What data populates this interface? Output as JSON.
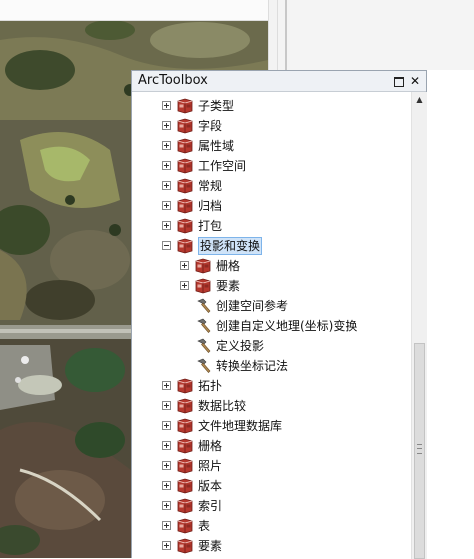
{
  "panel": {
    "title": "ArcToolbox",
    "restore_label": "",
    "close_label": "✕"
  },
  "tree": {
    "items": [
      {
        "label": "子类型",
        "type": "toolbox",
        "expander": "plus"
      },
      {
        "label": "字段",
        "type": "toolbox",
        "expander": "plus"
      },
      {
        "label": "属性域",
        "type": "toolbox",
        "expander": "plus"
      },
      {
        "label": "工作空间",
        "type": "toolbox",
        "expander": "plus"
      },
      {
        "label": "常规",
        "type": "toolbox",
        "expander": "plus"
      },
      {
        "label": "归档",
        "type": "toolbox",
        "expander": "plus"
      },
      {
        "label": "打包",
        "type": "toolbox",
        "expander": "plus"
      },
      {
        "label": "投影和变换",
        "type": "toolbox",
        "expander": "minus",
        "selected": true
      },
      {
        "label": "栅格",
        "type": "toolbox",
        "expander": "plus",
        "child": true
      },
      {
        "label": "要素",
        "type": "toolbox",
        "expander": "plus",
        "child": true
      },
      {
        "label": "创建空间参考",
        "type": "tool",
        "child": true
      },
      {
        "label": "创建自定义地理(坐标)变换",
        "type": "tool",
        "child": true
      },
      {
        "label": "定义投影",
        "type": "tool",
        "child": true
      },
      {
        "label": "转换坐标记法",
        "type": "tool",
        "child": true
      },
      {
        "label": "拓扑",
        "type": "toolbox",
        "expander": "plus"
      },
      {
        "label": "数据比较",
        "type": "toolbox",
        "expander": "plus"
      },
      {
        "label": "文件地理数据库",
        "type": "toolbox",
        "expander": "plus"
      },
      {
        "label": "栅格",
        "type": "toolbox",
        "expander": "plus"
      },
      {
        "label": "照片",
        "type": "toolbox",
        "expander": "plus"
      },
      {
        "label": "版本",
        "type": "toolbox",
        "expander": "plus"
      },
      {
        "label": "索引",
        "type": "toolbox",
        "expander": "plus"
      },
      {
        "label": "表",
        "type": "toolbox",
        "expander": "plus"
      },
      {
        "label": "要素",
        "type": "toolbox",
        "expander": "plus"
      }
    ]
  },
  "icons": {
    "toolbox": "red-toolbox-icon",
    "tool": "hammer-icon",
    "expand": "plus-box-icon",
    "collapse": "minus-box-icon",
    "scroll_up": "triangle-up-icon"
  },
  "colors": {
    "toolbox_red": "#b5382e",
    "selection_bg": "#cfe3f8",
    "selection_border": "#7eb4ea",
    "titlebar_bg": "#eef1f5"
  }
}
